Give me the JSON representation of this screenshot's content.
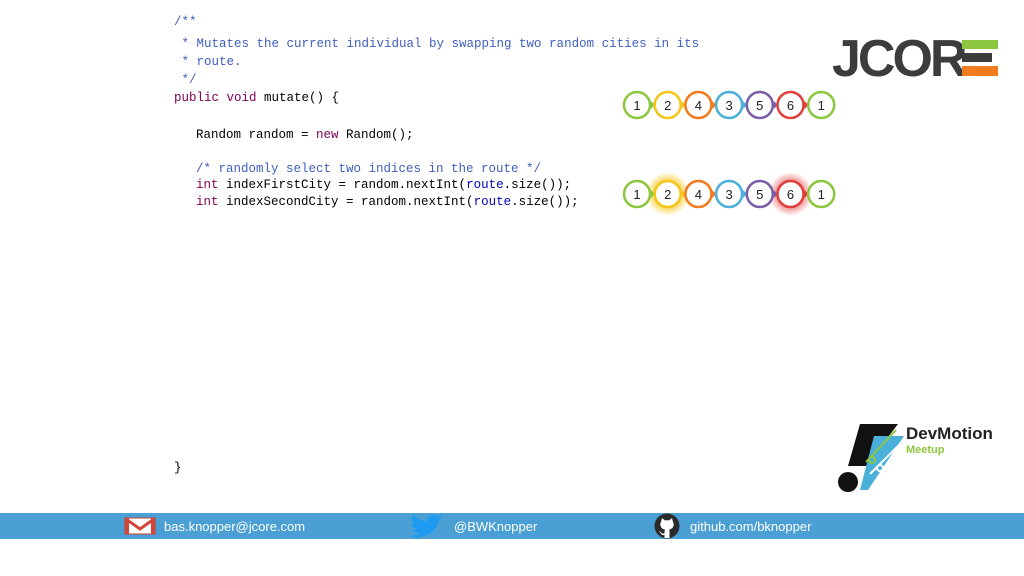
{
  "code": {
    "lines": [
      {
        "text": "/**"
      },
      {
        "text": " * Mutates the current individual by swapping two random cities in its"
      },
      {
        "text": " * route."
      },
      {
        "text": " */"
      },
      {
        "p1": "public void",
        "p2": " mutate() {"
      },
      {
        "p1": "Random random = ",
        "p2": "new",
        "p3": " Random();"
      },
      {
        "text": "/* randomly select two indices in the route */"
      },
      {
        "p1": "int",
        "p2": " indexFirstCity = random.nextInt(",
        "p3": "route",
        "p4": ".size());"
      },
      {
        "p1": "int",
        "p2": " indexSecondCity = random.nextInt(",
        "p3": "route",
        "p4": ".size());"
      },
      {
        "text": "}"
      }
    ]
  },
  "logo": {
    "text": "JCORE",
    "accent": "#f07c1f",
    "green": "#8dc63f",
    "dark": "#3c3c3c"
  },
  "route_top": [
    "1",
    "2",
    "4",
    "3",
    "5",
    "6",
    "1"
  ],
  "route_bottom": [
    "1",
    "2",
    "4",
    "3",
    "5",
    "6",
    "1"
  ],
  "node_colors": [
    "#8dc63f",
    "#f5c518",
    "#f07c1f",
    "#4ab0d9",
    "#7b5ea7",
    "#e0403c",
    "#8dc63f"
  ],
  "highlighted_bottom": [
    1,
    5
  ],
  "devmotion": {
    "title": "DevMotion",
    "subtitle": "Meetup"
  },
  "footer": {
    "email": "bas.knopper@jcore.com",
    "twitter": "@BWKnopper",
    "github": "github.com/bknopper",
    "background": "#4a9fd4"
  }
}
